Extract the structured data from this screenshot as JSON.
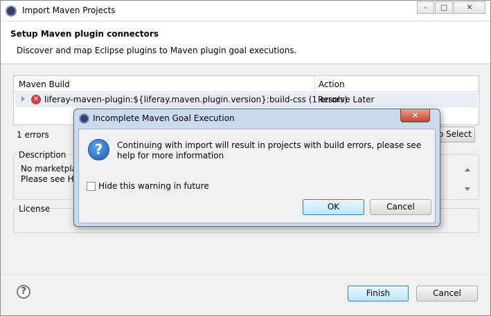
{
  "window": {
    "title": "Import Maven Projects",
    "controls": [
      "–",
      "□",
      "✕"
    ]
  },
  "header": {
    "title": "Setup Maven plugin connectors",
    "subtitle": "Discover and map Eclipse plugins to Maven plugin goal executions."
  },
  "table": {
    "columns": [
      "Maven Build",
      "Action"
    ],
    "rows": [
      {
        "build": "liferay-maven-plugin:${liferay.maven.plugin.version}:build-css (1 errors)",
        "action": "Resolve Later"
      }
    ]
  },
  "errors_label": "1 errors",
  "select_button": "to Select",
  "description": {
    "label": "Description",
    "lines": [
      "No marketplac",
      "Please see Hel"
    ]
  },
  "license": {
    "label": "License"
  },
  "footer": {
    "help": "?",
    "finish": "Finish",
    "cancel": "Cancel"
  },
  "dialog": {
    "title": "Incomplete Maven Goal Execution",
    "close": "✕",
    "message": "Continuing with import will result in projects with build errors, please see help for more information",
    "checkbox_label": "Hide this warning in future",
    "checkbox_checked": false,
    "ok": "OK",
    "cancel": "Cancel"
  }
}
